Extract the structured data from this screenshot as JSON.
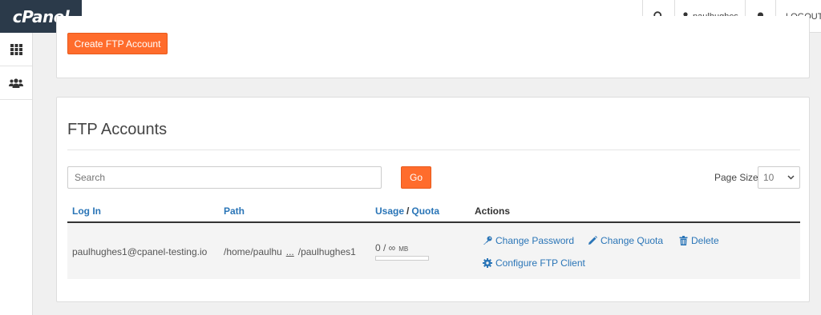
{
  "app": {
    "logo": "cPanel"
  },
  "topbar": {
    "user": "paulhughes",
    "logout": "LOGOUT"
  },
  "create_button": "Create FTP Account",
  "section": {
    "title": "FTP Accounts",
    "search_placeholder": "Search",
    "go_label": "Go",
    "page_size_label": "Page Size",
    "page_size_value": "10"
  },
  "table": {
    "headers": {
      "login": "Log In",
      "path": "Path",
      "usage": "Usage",
      "slash": "/",
      "quota": "Quota",
      "actions": "Actions"
    },
    "rows": [
      {
        "login": "paulhughes1@cpanel-testing.io",
        "path_start": "/home/paulhu",
        "path_ellipsis": "...",
        "path_end": "/paulhughes1",
        "usage": "0 / ∞",
        "usage_unit": "MB",
        "usage_fraction": 0,
        "actions": {
          "change_password": "Change Password",
          "change_quota": "Change Quota",
          "delete": "Delete",
          "configure": "Configure FTP Client"
        }
      }
    ]
  }
}
